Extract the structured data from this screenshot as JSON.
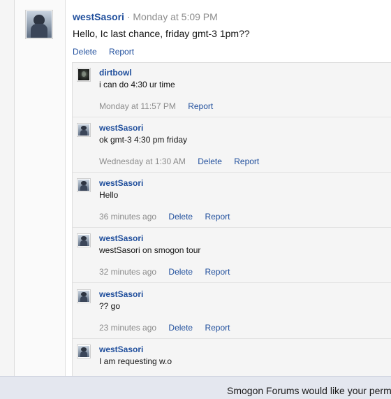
{
  "post": {
    "username": "westSasori",
    "separator": "·",
    "time": "Monday at 5:09 PM",
    "body": "Hello, Ic last chance, friday gmt-3 1pm??",
    "delete_label": "Delete",
    "report_label": "Report"
  },
  "comments": [
    {
      "username": "dirtbowl",
      "text": "i can do 4:30 ur time",
      "time": "Monday at 11:57 PM",
      "report_label": "Report"
    },
    {
      "username": "westSasori",
      "text": "ok gmt-3 4:30 pm friday",
      "time": "Wednesday at 1:30 AM",
      "delete_label": "Delete",
      "report_label": "Report"
    },
    {
      "username": "westSasori",
      "text": "Hello",
      "time": "36 minutes ago",
      "delete_label": "Delete",
      "report_label": "Report"
    },
    {
      "username": "westSasori",
      "text": "westSasori on smogon tour",
      "time": "32 minutes ago",
      "delete_label": "Delete",
      "report_label": "Report"
    },
    {
      "username": "westSasori",
      "text": "?? go",
      "time": "23 minutes ago",
      "delete_label": "Delete",
      "report_label": "Report"
    },
    {
      "username": "westSasori",
      "text": "I am requesting w.o"
    }
  ],
  "notification": {
    "text": "Smogon Forums would like your permis"
  }
}
